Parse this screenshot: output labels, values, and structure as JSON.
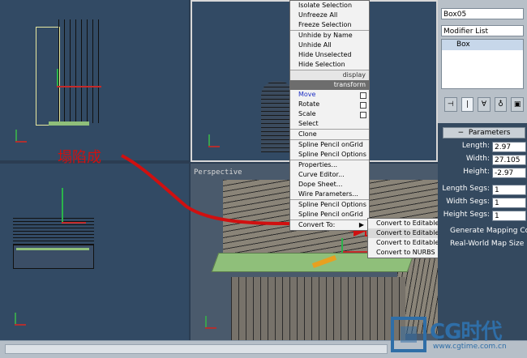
{
  "viewports": {
    "perspective_label": "Perspective"
  },
  "command_panel": {
    "object_name": "Box05",
    "modifier_list": "Modifier List",
    "stack_item": "Box",
    "rollout_title": "Parameters",
    "length_label": "Length:",
    "length_value": "2.97",
    "width_label": "Width:",
    "width_value": "27.105",
    "height_label": "Height:",
    "height_value": "-2.97",
    "length_segs_label": "Length Segs:",
    "length_segs_value": "1",
    "width_segs_label": "Width Segs:",
    "width_segs_value": "1",
    "height_segs_label": "Height Segs:",
    "height_segs_value": "1",
    "gen_mapping": "Generate Mapping Coor",
    "real_world": "Real-World Map Size"
  },
  "quad_menu": {
    "items": [
      "Isolate Selection",
      "Unfreeze All",
      "Freeze Selection",
      "Unhide by Name",
      "Unhide All",
      "Hide Unselected",
      "Hide Selection"
    ],
    "display_header": "display",
    "transform_header": "transform",
    "transform_items": [
      "Move",
      "Rotate",
      "Scale",
      "Select"
    ],
    "lower_items": [
      "Clone",
      "Spline Pencil onGrid",
      "Spline Pencil Options",
      "Properties...",
      "Curve Editor...",
      "Dope Sheet...",
      "Wire Parameters...",
      "Spline Pencil Options",
      "Spline Pencil onGrid",
      "Convert To:"
    ]
  },
  "submenu": {
    "items": [
      "Convert to Editable Mesh",
      "Convert to Editable Poly",
      "Convert to Editable Patch",
      "Convert to NURBS"
    ]
  },
  "annotation": {
    "text": "塌陷成"
  },
  "logo": {
    "brand": "CG时代",
    "url": "www.cgtime.com.cn"
  },
  "colors": {
    "viewport_bg": "#324a64",
    "annotation_red": "#d01010",
    "poly_green": "#8fbf7a"
  }
}
